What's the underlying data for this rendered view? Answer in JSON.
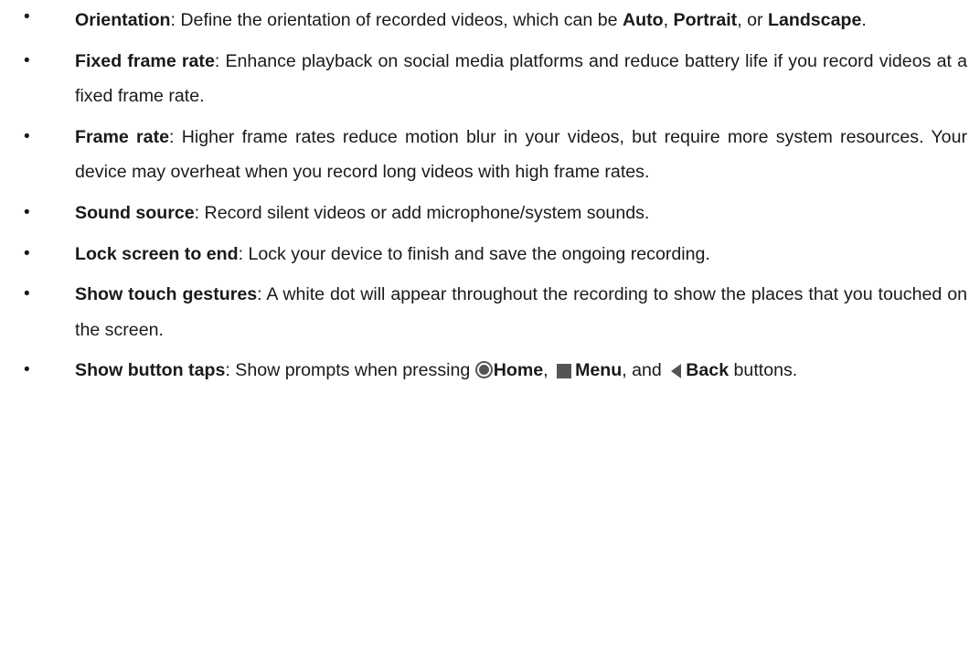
{
  "bullet_char": "•",
  "items": [
    {
      "term": "Orientation",
      "text1": ": Define the orientation of recorded videos, which can be ",
      "opt1": "Auto",
      "sep1": ", ",
      "opt2": "Portrait",
      "sep2": ", or ",
      "opt3": "Landscape",
      "end": "."
    },
    {
      "term": "Fixed frame rate",
      "text": ": Enhance playback on social media platforms and reduce battery life if you record videos at a fixed frame rate."
    },
    {
      "term": "Frame rate",
      "text": ": Higher frame rates reduce motion blur in your videos, but require more system resources. Your device may overheat when you record long videos with high frame rates."
    },
    {
      "term": "Sound source",
      "text": ": Record silent videos or add microphone/system sounds."
    },
    {
      "term": "Lock screen to end",
      "text": ": Lock your device to finish and save the ongoing recording."
    },
    {
      "term": "Show touch gestures",
      "text": ": A white dot will appear throughout the recording to show the places that you touched on the screen."
    },
    {
      "term": "Show button taps",
      "text1": ": Show prompts when pressing ",
      "home": "Home",
      "sep1": ", ",
      "menu": "Menu",
      "sep2": ", and ",
      "back": "Back",
      "end": " buttons."
    }
  ],
  "icons": {
    "home": "home-circle-icon",
    "menu": "menu-square-icon",
    "back": "back-triangle-icon"
  },
  "colors": {
    "text": "#1a1a1a",
    "icon": "#555555"
  }
}
